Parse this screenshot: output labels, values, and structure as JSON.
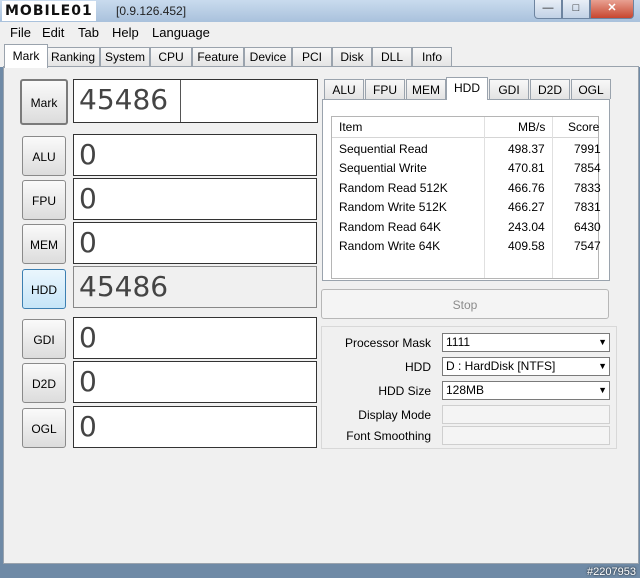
{
  "window": {
    "logo_text": "MOBILE01",
    "title": "[0.9.126.452]",
    "buttons": [
      "—",
      "□",
      "✕"
    ]
  },
  "menu": [
    "File",
    "Edit",
    "Tab",
    "Help",
    "Language"
  ],
  "main_tabs": [
    "Mark",
    "Ranking",
    "System",
    "CPU",
    "Feature",
    "Device",
    "PCI",
    "Disk",
    "DLL",
    "Info"
  ],
  "active_main_tab": "Mark",
  "scores": [
    {
      "label": "Mark",
      "value": "45486"
    },
    {
      "label": "ALU",
      "value": "0"
    },
    {
      "label": "FPU",
      "value": "0"
    },
    {
      "label": "MEM",
      "value": "0"
    },
    {
      "label": "HDD",
      "value": "45486"
    },
    {
      "label": "GDI",
      "value": "0"
    },
    {
      "label": "D2D",
      "value": "0"
    },
    {
      "label": "OGL",
      "value": "0"
    }
  ],
  "sub_tabs": [
    "ALU",
    "FPU",
    "MEM",
    "HDD",
    "GDI",
    "D2D",
    "OGL"
  ],
  "active_sub_tab": "HDD",
  "results": {
    "columns": [
      "Item",
      "MB/s",
      "Score"
    ],
    "rows": [
      [
        "Sequential Read",
        "498.37",
        "7991"
      ],
      [
        "Sequential Write",
        "470.81",
        "7854"
      ],
      [
        "Random Read 512K",
        "466.76",
        "7833"
      ],
      [
        "Random Write 512K",
        "466.27",
        "7831"
      ],
      [
        "Random Read 64K",
        "243.04",
        "6430"
      ],
      [
        "Random Write 64K",
        "409.58",
        "7547"
      ]
    ]
  },
  "stop_label": "Stop",
  "settings": {
    "processor_mask_label": "Processor Mask",
    "processor_mask_value": "1111",
    "hdd_label": "HDD",
    "hdd_value": "D : HardDisk [NTFS]",
    "hdd_size_label": "HDD Size",
    "hdd_size_value": "128MB",
    "display_mode_label": "Display Mode",
    "font_smoothing_label": "Font Smoothing"
  },
  "watermark": "#2207953"
}
